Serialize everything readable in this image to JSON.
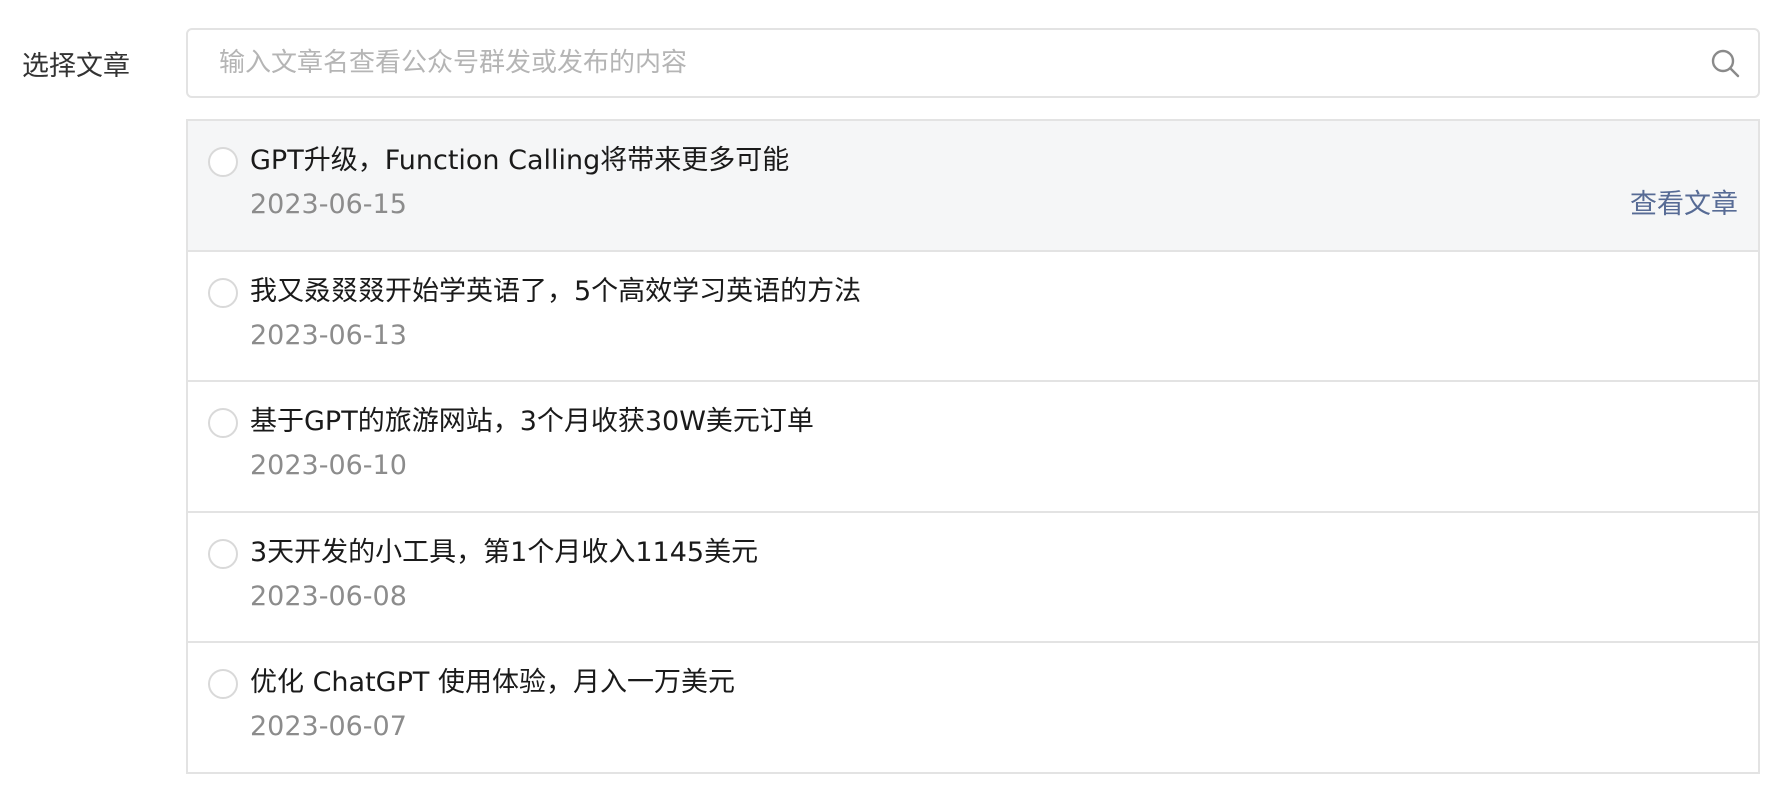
{
  "form": {
    "label": "选择文章"
  },
  "search": {
    "placeholder": "输入文章名查看公众号群发或发布的内容",
    "value": "",
    "icon": "search-icon"
  },
  "articles": [
    {
      "title": "GPT升级，Function Calling将带来更多可能",
      "date": "2023-06-15",
      "selected": false,
      "hovered": true,
      "view_label": "查看文章"
    },
    {
      "title": "我又叒叕叕开始学英语了，5个高效学习英语的方法",
      "date": "2023-06-13",
      "selected": false
    },
    {
      "title": "基于GPT的旅游网站，3个月收获30W美元订单",
      "date": "2023-06-10",
      "selected": false
    },
    {
      "title": "3天开发的小工具，第1个月收入1145美元",
      "date": "2023-06-08",
      "selected": false
    },
    {
      "title": "优化 ChatGPT 使用体验，月入一万美元",
      "date": "2023-06-07",
      "selected": false
    }
  ],
  "colors": {
    "hover_background": "#f5f6f7",
    "link": "#576b95",
    "date": "#8c8c8c",
    "border": "#e3e3e3"
  }
}
